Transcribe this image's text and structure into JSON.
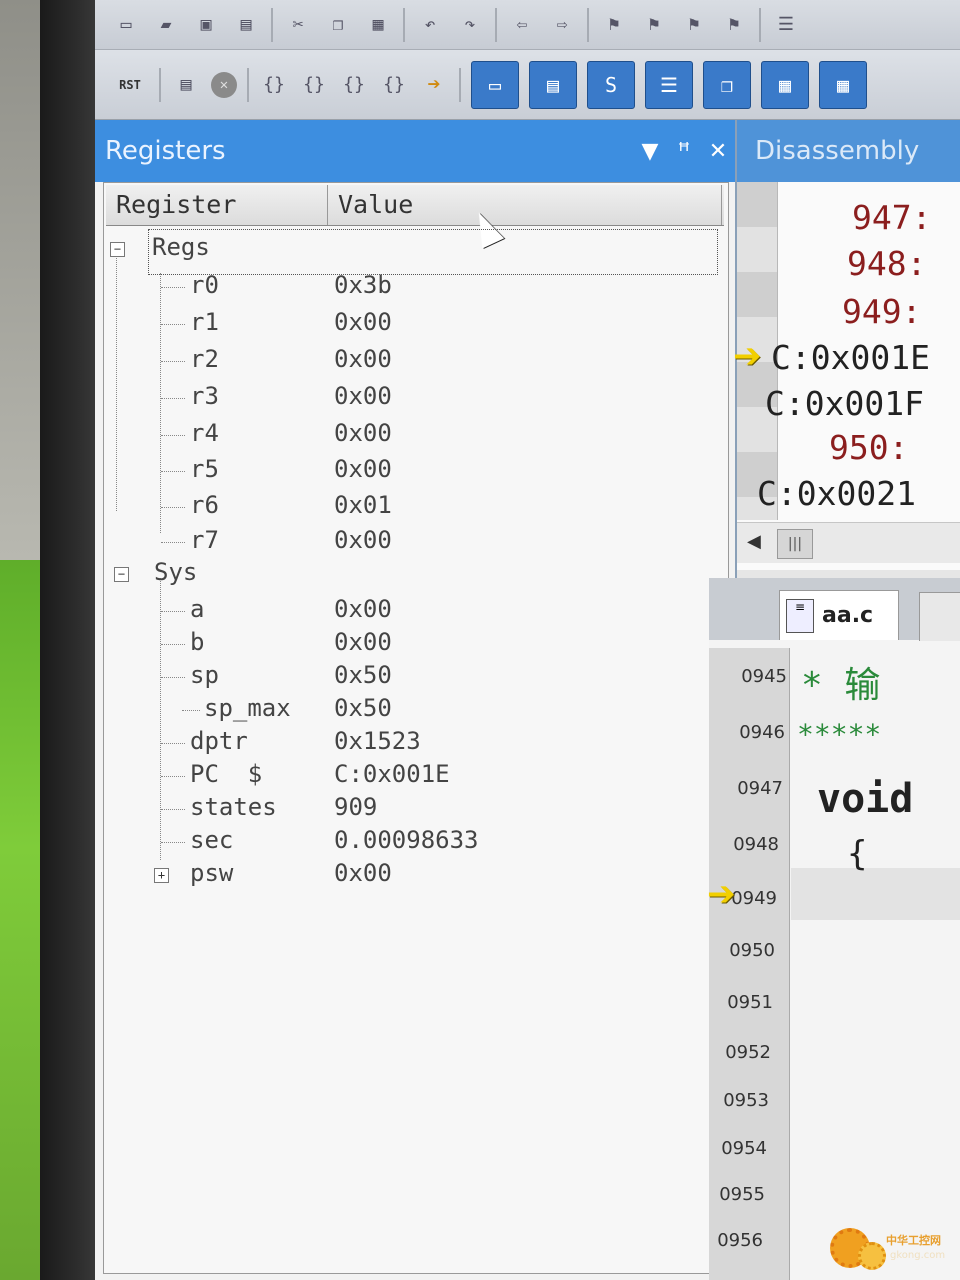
{
  "registers_panel": {
    "title": "Registers",
    "columns": [
      "Register",
      "Value"
    ],
    "controls": {
      "dropdown": "▼",
      "pin": "ꟸ",
      "close": "✕"
    },
    "groups": [
      {
        "name": "Regs",
        "rows": [
          {
            "name": "r0",
            "value": "0x3b"
          },
          {
            "name": "r1",
            "value": "0x00"
          },
          {
            "name": "r2",
            "value": "0x00"
          },
          {
            "name": "r3",
            "value": "0x00"
          },
          {
            "name": "r4",
            "value": "0x00"
          },
          {
            "name": "r5",
            "value": "0x00"
          },
          {
            "name": "r6",
            "value": "0x01"
          },
          {
            "name": "r7",
            "value": "0x00"
          }
        ]
      },
      {
        "name": "Sys",
        "rows": [
          {
            "name": "a",
            "value": "0x00"
          },
          {
            "name": "b",
            "value": "0x00"
          },
          {
            "name": "sp",
            "value": "0x50"
          },
          {
            "name": "sp_max",
            "value": "0x50"
          },
          {
            "name": "dptr",
            "value": "0x1523"
          },
          {
            "name": "PC  $",
            "value": "C:0x001E"
          },
          {
            "name": "states",
            "value": "909"
          },
          {
            "name": "sec",
            "value": "0.00098633"
          },
          {
            "name": "psw",
            "value": "0x00"
          }
        ]
      }
    ]
  },
  "toolbar": {
    "rst_label": "RST"
  },
  "disassembly": {
    "title": "Disassembly",
    "lines": [
      "947:",
      "948:",
      "949:",
      "C:0x001E",
      "C:0x001F",
      "950:",
      "C:0x0021"
    ]
  },
  "editor": {
    "tab_label": "aa.c",
    "line_numbers": [
      "0945",
      "0946",
      "0947",
      "0948",
      "0949",
      "0950",
      "0951",
      "0952",
      "0953",
      "0954",
      "0955",
      "0956"
    ],
    "code": {
      "line_0945": "* 输",
      "line_0946": "*****",
      "line_0947": "void",
      "line_0948": "{"
    }
  },
  "watermark": {
    "text": "中华工控网",
    "sub": "gkong.com"
  },
  "colors": {
    "panel_title_bg": "#3d8ee0",
    "current_line_arrow": "#f2cf00"
  }
}
